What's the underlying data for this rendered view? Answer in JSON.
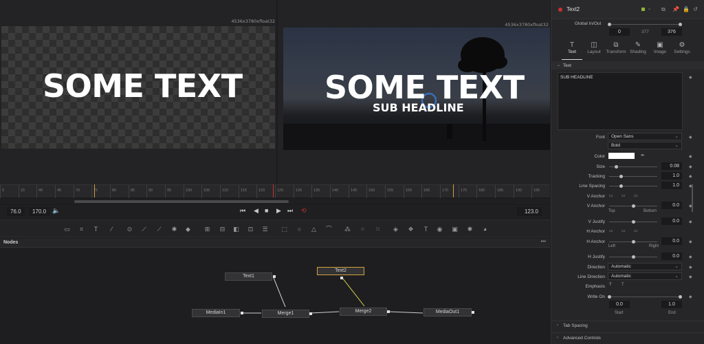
{
  "viewer_left": {
    "resolution": "4536x3780xfloat32",
    "text": "SOME TEXT"
  },
  "viewer_right": {
    "resolution": "4536x3780xfloat32",
    "text": "SOME TEXT",
    "subtext": "SUB HEADLINE"
  },
  "ruler": {
    "labels": [
      "0",
      "15",
      "40",
      "45",
      "70",
      "75",
      "80",
      "85",
      "90",
      "95",
      "100",
      "105",
      "110",
      "115",
      "120",
      "125",
      "130",
      "135",
      "140",
      "145",
      "150",
      "155",
      "160",
      "165",
      "170",
      "175",
      "180",
      "185",
      "190",
      "195"
    ]
  },
  "transport": {
    "start": "76.0",
    "end": "170.0",
    "current": "123.0"
  },
  "nodes": {
    "title": "Nodes",
    "menu": "•••",
    "items": {
      "text1": "Text1",
      "text2": "Text2",
      "mediain1": "MediaIn1",
      "merge1": "Merge1",
      "merge2": "Merge2",
      "mediaout1": "MediaOut1"
    }
  },
  "inspector": {
    "node_name": "Text2",
    "global_inout_label": "Global In/Out",
    "global_in": "0",
    "global_mid": "377",
    "global_out": "376",
    "tabs": [
      {
        "label": "Text",
        "icon": "T"
      },
      {
        "label": "Layout",
        "icon": "◫"
      },
      {
        "label": "Transform",
        "icon": "⧉"
      },
      {
        "label": "Shading",
        "icon": "✎"
      },
      {
        "label": "Image",
        "icon": "▣"
      },
      {
        "label": "Settings",
        "icon": "⚙"
      }
    ],
    "section_text": "Text",
    "styled_text": "SUB HEADLINE",
    "font_label": "Font",
    "font_value": "Open Sans",
    "font_style": "Bold",
    "color_label": "Color",
    "size_label": "Size",
    "size_value": "0.08",
    "tracking_label": "Tracking",
    "tracking_value": "1.0",
    "line_spacing_label": "Line Spacing",
    "line_spacing_value": "1.0",
    "v_anchor_label": "V Anchor",
    "v_anchor2_label": "V Anchor",
    "v_anchor_value": "0.0",
    "top_label": "Top",
    "bottom_label": "Bottom",
    "v_justify_label": "V Justify",
    "v_justify_value": "0.0",
    "h_anchor_label": "H Anchor",
    "h_anchor2_label": "H Anchor",
    "h_anchor_value": "0.0",
    "left_label": "Left",
    "right_label": "Right",
    "h_justify_label": "H Justify",
    "h_justify_value": "0.0",
    "direction_label": "Direction",
    "direction_value": "Automatic",
    "line_direction_label": "Line Direction",
    "line_direction_value": "Automatic",
    "emphasis_label": "Emphasis",
    "write_on_label": "Write On",
    "write_on_start": "0.0",
    "write_on_end": "1.0",
    "start_label": "Start",
    "end_label": "End",
    "tab_spacing": "Tab Spacing",
    "advanced_controls": "Advanced Controls"
  },
  "colors": {
    "accent_yellow": "#d2a23c",
    "playhead_red": "#c83232",
    "color_swatch": "#ffffff"
  }
}
